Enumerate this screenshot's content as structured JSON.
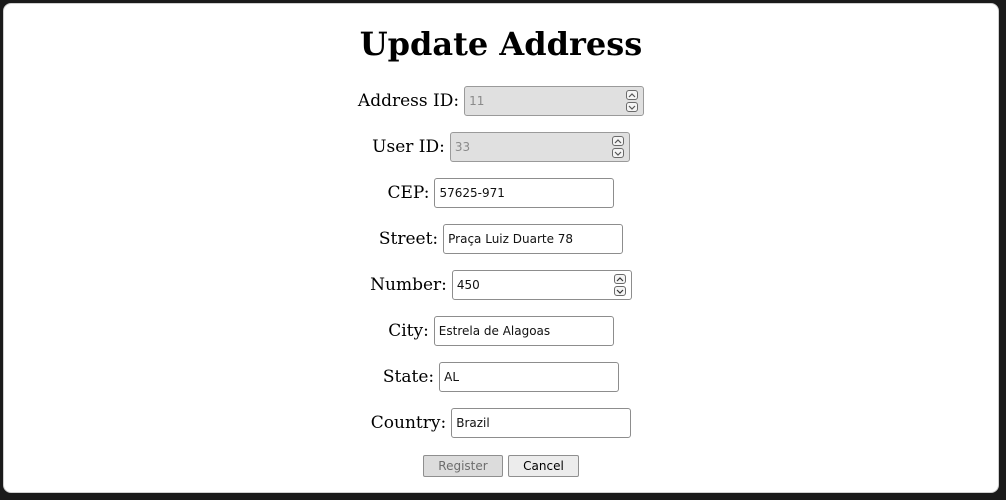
{
  "page": {
    "title": "Update Address"
  },
  "form": {
    "address_id": {
      "label": "Address ID:",
      "value": "11"
    },
    "user_id": {
      "label": "User ID:",
      "value": "33"
    },
    "cep": {
      "label": "CEP:",
      "value": "57625-971"
    },
    "street": {
      "label": "Street:",
      "value": "Praça Luiz Duarte 78"
    },
    "number": {
      "label": "Number:",
      "value": "450"
    },
    "city": {
      "label": "City:",
      "value": "Estrela de Alagoas"
    },
    "state": {
      "label": "State:",
      "value": "AL"
    },
    "country": {
      "label": "Country:",
      "value": "Brazil"
    }
  },
  "actions": {
    "register_label": "Register",
    "cancel_label": "Cancel"
  },
  "icons": {
    "spin_up": "chevron-up-icon",
    "spin_down": "chevron-down-icon"
  }
}
